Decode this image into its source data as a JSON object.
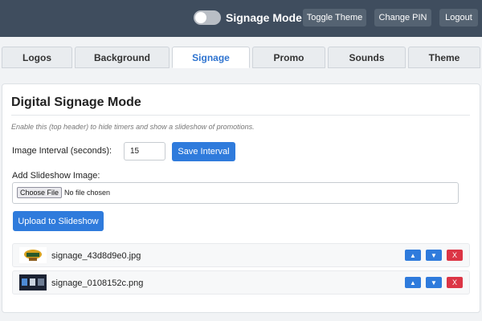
{
  "header": {
    "mode_label": "Signage Mode",
    "toggle_theme": "Toggle Theme",
    "change_pin": "Change PIN",
    "logout": "Logout"
  },
  "tabs": [
    {
      "label": "Logos"
    },
    {
      "label": "Background"
    },
    {
      "label": "Signage",
      "active": true
    },
    {
      "label": "Promo"
    },
    {
      "label": "Sounds"
    },
    {
      "label": "Theme"
    }
  ],
  "panel": {
    "title": "Digital Signage Mode",
    "description": "Enable this (top header) to hide timers and show a slideshow of promotions.",
    "interval_label": "Image Interval (seconds):",
    "interval_value": "15",
    "save_interval": "Save Interval",
    "add_image_label": "Add Slideshow Image:",
    "choose_file": "Choose File",
    "no_file": "No file chosen",
    "upload": "Upload to Slideshow"
  },
  "slides": [
    {
      "filename": "signage_43d8d9e0.jpg"
    },
    {
      "filename": "signage_0108152c.png"
    }
  ],
  "row_controls": {
    "up": "▲",
    "down": "▼",
    "delete": "X"
  },
  "colors": {
    "header_bg": "#3f4d5e",
    "accent": "#2f7bdc",
    "danger": "#dc3545",
    "active_tab_text": "#2f74d0"
  }
}
